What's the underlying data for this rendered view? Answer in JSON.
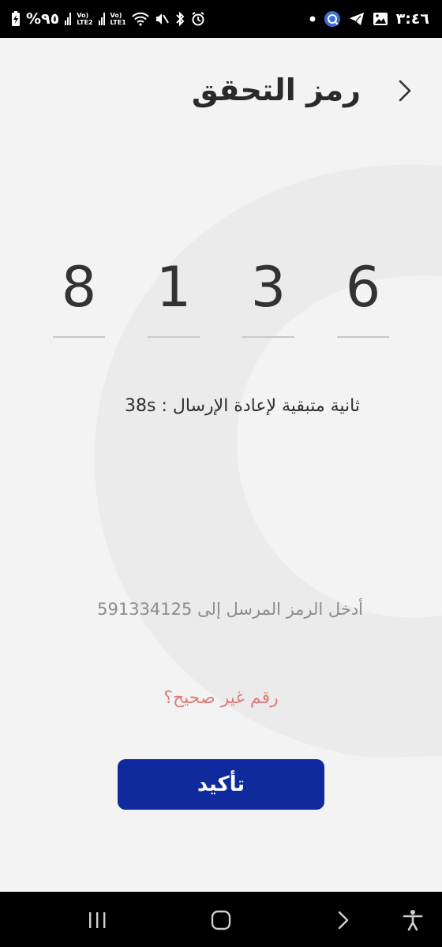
{
  "status_bar": {
    "time": "٣:٤٦",
    "battery": "%٩٥",
    "lte2": "LTE2",
    "lte1": "LTE1",
    "volte": "Vo)",
    "icons": [
      "battery-icon",
      "signal-icon",
      "wifi-icon",
      "mute-icon",
      "bluetooth-icon",
      "alarm-icon",
      "app-notification-icon",
      "telegram-icon",
      "gallery-icon",
      "notification-dot-icon"
    ]
  },
  "header": {
    "title": "رمز التحقق",
    "back_icon": "chevron-right-icon"
  },
  "code": {
    "digits": [
      "8",
      "1",
      "3",
      "6"
    ]
  },
  "timer": {
    "text": "ثانية متبقية لإعادة الإرسال : 38s"
  },
  "hint": {
    "text": "أدخل الرمز المرسل إلى 591334125"
  },
  "wrong_number": {
    "label": "رقم غير صحيح؟",
    "color": "#e07a78"
  },
  "confirm": {
    "label": "تأكيد",
    "color": "#0e2a9c"
  },
  "nav_bar": {
    "icons": [
      "recent-apps-icon",
      "home-icon",
      "back-icon",
      "accessibility-icon"
    ]
  }
}
